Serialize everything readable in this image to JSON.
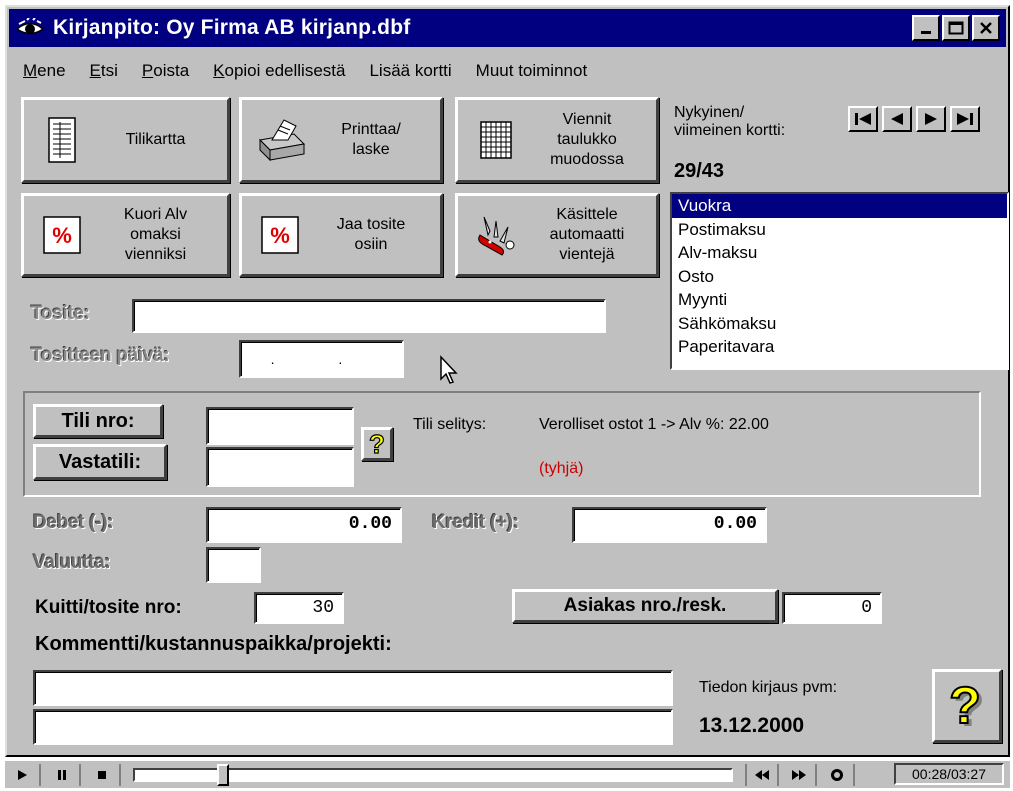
{
  "window": {
    "title": "Kirjanpito: Oy Firma AB kirjanp.dbf",
    "app_icon": "eye-icon",
    "controls": [
      "minimize-icon",
      "maximize-icon",
      "close-icon"
    ]
  },
  "menu": {
    "items": [
      {
        "hot": "M",
        "rest": "ene"
      },
      {
        "hot": "E",
        "rest": "tsi"
      },
      {
        "hot": "P",
        "rest": "oista"
      },
      {
        "hot": "K",
        "rest": "opioi edellisestä"
      },
      {
        "hot": "",
        "rest": "Lisää kortti"
      },
      {
        "hot": "",
        "rest": "Muut toiminnot"
      }
    ]
  },
  "buttons": {
    "tilikartta": {
      "label": "Tilikartta",
      "icon": "document-icon"
    },
    "printtaa": {
      "label": "Printtaa/\nlaske",
      "icon": "printer-icon"
    },
    "viennit": {
      "label": "Viennit\ntaulukko\nmuodossa",
      "icon": "grid-icon"
    },
    "kuori_alv": {
      "label": "Kuori Alv\nomaksi\nvienniksi",
      "icon": "percent-icon"
    },
    "jaa_tosite": {
      "label": "Jaa tosite\nosiin",
      "icon": "percent-icon"
    },
    "kasittele": {
      "label": "Käsittele\nautomaatti\nvientejä",
      "icon": "swiss-knife-icon"
    }
  },
  "navigation": {
    "label": "Nykyinen/\nviimeinen kortti:",
    "value": "29/43",
    "buttons": [
      "first-record-icon",
      "previous-record-icon",
      "next-record-icon",
      "last-record-icon"
    ]
  },
  "entry_types": {
    "selected": "Vuokra",
    "items": [
      "Vuokra",
      "Postimaksu",
      "Alv-maksu",
      "Osto",
      "Myynti",
      "Sähkömaksu",
      "Paperitavara"
    ]
  },
  "form": {
    "tosite_label": "Tosite:",
    "tosite_value": "",
    "date_label": "Tositteen päivä:",
    "date_value": ". .",
    "tili_nro_label": "Tili nro:",
    "tili_nro_value": "",
    "vastatili_label": "Vastatili:",
    "vastatili_value": "",
    "help_icon": "question-mark-icon",
    "tili_selitys_label": "Tili selitys:",
    "tili_selitys_value": "Verolliset ostot 1 -> Alv %: 22.00",
    "vastatili_selitys_value": "(tyhjä)",
    "debet_label": "Debet (-):",
    "debet_value": "0.00",
    "kredit_label": "Kredit (+):",
    "kredit_value": "0.00",
    "valuutta_label": "Valuutta:",
    "valuutta_value": "",
    "kuitti_label": "Kuitti/tosite nro:",
    "kuitti_value": "30",
    "asiakas_label": "Asiakas nro./resk.",
    "asiakas_value": "0",
    "kommentti_label": "Kommentti/kustannuspaikka/projekti:",
    "kommentti_line1": "",
    "kommentti_line2": "",
    "kirjaus_label": "Tiedon kirjaus pvm:",
    "kirjaus_value": "13.12.2000"
  },
  "colors": {
    "window_bg": "#c0c0c0",
    "titlebar": "#000080",
    "selection": "#000080",
    "warning_text": "#cc0000",
    "percent_icon": "#e00000",
    "help_icon": "#ffff00"
  },
  "media": {
    "timecode": "00:28/03:27",
    "progress": 0.14,
    "buttons": [
      "play-icon",
      "pause-icon",
      "stop-icon"
    ]
  }
}
